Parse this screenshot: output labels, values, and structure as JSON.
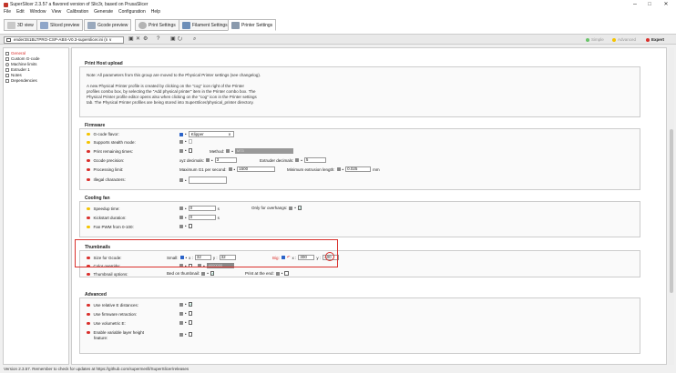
{
  "window": {
    "title": "SuperSlicer 2.3.57 a flavored version of Slic3r, based on PrusaSlicer",
    "minimize_label": "–",
    "maximize_label": "□",
    "close_label": "✕"
  },
  "menu": [
    "File",
    "Edit",
    "Window",
    "View",
    "Calibration",
    "Generate",
    "Configuration",
    "Help"
  ],
  "tabs": [
    {
      "label": "3D view",
      "icon": "cube-icon"
    },
    {
      "label": "Sliced preview",
      "icon": "layers-icon"
    },
    {
      "label": "Gcode preview",
      "icon": "gcode-icon"
    },
    {
      "label": "Print Settings",
      "icon": "gear-icon"
    },
    {
      "label": "Filament Settings",
      "icon": "filament-icon"
    },
    {
      "label": "Printer Settings",
      "icon": "printer-icon"
    }
  ],
  "toolbar": {
    "profile": "ender3S1BLTPRO-CSP-ABS-V0.3-superslicer.ini (n ∨",
    "icons": [
      "▣",
      "✕",
      "⚙",
      "?",
      "▣",
      "⭮",
      "⌕"
    ],
    "modes": [
      {
        "label": "Simple",
        "color": "#6ac46a"
      },
      {
        "label": "Advanced",
        "color": "#f5c400"
      },
      {
        "label": "Expert",
        "color": "#d9302c"
      }
    ]
  },
  "sidebar": {
    "items": [
      "General",
      "Custom G-code",
      "Machine limits",
      "Extruder 1",
      "Notes",
      "Dependencies"
    ]
  },
  "print_host": {
    "title": "Print Host upload",
    "note1": "Note: All parameters from this group are moved to the Physical Printer settings (see changelog).",
    "note2_lines": [
      "A new Physical Printer profile is created by clicking on the \"cog\" icon right of the Printer",
      "profiles combo box, by selecting the \"Add physical printer\" item in the Printer combo box. The",
      "Physical Printer profile editor opens also when clicking on the \"cog\" icon in the Printer settings",
      "tab. The Physical Printer profiles are being stored into SuperSlicer/physical_printer directory."
    ]
  },
  "firmware": {
    "title": "Firmware",
    "rows": [
      {
        "label": "G-code flavor:",
        "color": "#f5c400"
      },
      {
        "label": "Supports stealth mode:",
        "color": "#f5c400"
      },
      {
        "label": "Print remaining times:",
        "color": "#d9302c"
      },
      {
        "label": "Gcode precision:",
        "color": "#d9302c"
      },
      {
        "label": "Processing limit:",
        "color": "#d9302c"
      },
      {
        "label": "Illegal characters:",
        "color": "#d9302c"
      }
    ],
    "flavor_value": "Klipper",
    "method_label": "Method:",
    "method_value": "M73",
    "xyz_label": "xyz decimals:",
    "xyz_value": "3",
    "extruder_label": "Extruder decimals:",
    "extruder_value": "5",
    "max_g1_label": "Maximum G1 per second:",
    "max_g1_value": "1500",
    "min_ext_label": "Minimum extrusion length:",
    "min_ext_value": "0.025",
    "min_ext_unit": "mm"
  },
  "cooling": {
    "title": "Cooling fan",
    "rows": [
      {
        "label": "Speedup time:",
        "color": "#f5c400"
      },
      {
        "label": "Kickstart duration:",
        "color": "#d9302c"
      },
      {
        "label": "Fan PWM from 0-100:",
        "color": "#f5c400"
      }
    ],
    "speedup_value": "0",
    "speedup_unit": "s",
    "overhangs_label": "Only for overhangs:",
    "kickstart_value": "0",
    "kickstart_unit": "s"
  },
  "thumbnails": {
    "title": "Thumbnails",
    "rows": [
      {
        "label": "Size for Gcode:",
        "color": "#d9302c"
      },
      {
        "label": "Color override:",
        "color": "#d9302c"
      },
      {
        "label": "Thumbnail options:",
        "color": "#d9302c"
      }
    ],
    "small_label": "Small:",
    "small_x_label": "x :",
    "small_x": "32",
    "small_y_label": "y :",
    "small_y": "32",
    "big_label": "Big:",
    "big_x_label": "x :",
    "big_x": "300",
    "big_y_label": "y :",
    "big_y": "400",
    "color_value": "#000000",
    "bed_label": "Bed on thumbnail:",
    "print_end_label": "Print at the end:"
  },
  "advanced": {
    "title": "Advanced",
    "rows": [
      {
        "label": "Use relative E distances:",
        "color": "#d9302c"
      },
      {
        "label": "Use firmware retraction:",
        "color": "#d9302c"
      },
      {
        "label": "Use volumetric E:",
        "color": "#d9302c"
      },
      {
        "label": "Enable variable layer height",
        "color": "#d9302c"
      }
    ],
    "last_row_line2": "feature:"
  },
  "status": "Version 2.3.57. Remember to check for updates at https://github.com/supermerill/SuperSlicer/releases",
  "accent": "#2a62c8",
  "highlight": "#d9302c"
}
